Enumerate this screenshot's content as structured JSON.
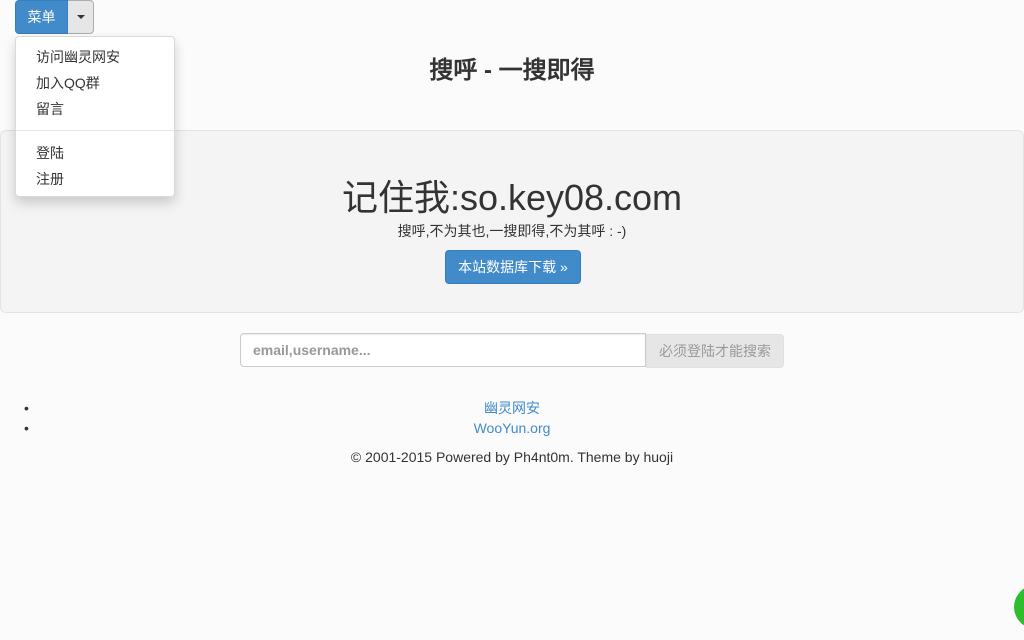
{
  "menu": {
    "label": "菜单",
    "items": [
      "访问幽灵网安",
      "加入QQ群",
      "留言"
    ],
    "account_items": [
      "登陆",
      "注册"
    ]
  },
  "header": {
    "title": "搜呼 - 一搜即得"
  },
  "jumbotron": {
    "title": "记住我:so.key08.com",
    "subtitle": "搜呼,不为其也,一搜即得,不为其呼 : -)",
    "download_label": "本站数据库下载 »"
  },
  "search": {
    "placeholder": "email,username...",
    "button_label": "必须登陆才能搜索"
  },
  "links": [
    "幽灵网安",
    "WooYun.org"
  ],
  "footer": {
    "text": "© 2001-2015 Powered by Ph4nt0m. Theme by huoji"
  },
  "colors": {
    "primary": "#428bca",
    "jumbotron_bg": "#f4f4f4",
    "widget": "#2ebd2e"
  }
}
